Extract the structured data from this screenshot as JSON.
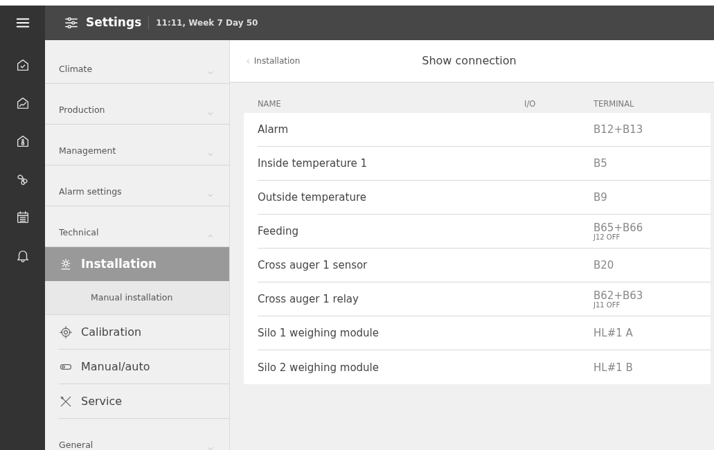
{
  "header": {
    "title": "Settings",
    "clock": "11:11, Week 7 Day 50"
  },
  "sidebar": {
    "groups": [
      {
        "label": "Climate",
        "expanded": false
      },
      {
        "label": "Production",
        "expanded": false
      },
      {
        "label": "Management",
        "expanded": false
      },
      {
        "label": "Alarm settings",
        "expanded": false
      },
      {
        "label": "Technical",
        "expanded": true,
        "items": [
          {
            "label": "Installation",
            "selected": true,
            "children": [
              {
                "label": "Manual installation",
                "selected": false
              }
            ]
          },
          {
            "label": "Calibration",
            "selected": false
          },
          {
            "label": "Manual/auto",
            "selected": false
          },
          {
            "label": "Service",
            "selected": false
          }
        ]
      },
      {
        "label": "General",
        "expanded": false
      }
    ]
  },
  "page": {
    "back": "Installation",
    "title": "Show connection"
  },
  "table": {
    "columns": [
      "NAME",
      "I/O",
      "TERMINAL"
    ],
    "rows": [
      {
        "name": "Alarm",
        "terminal": "B12+B13"
      },
      {
        "name": "Inside temperature 1",
        "terminal": "B5"
      },
      {
        "name": "Outside temperature",
        "terminal": "B9"
      },
      {
        "name": "Feeding",
        "terminal": "B65+B66",
        "note": "J12 OFF"
      },
      {
        "name": "Cross auger 1 sensor",
        "terminal": "B20"
      },
      {
        "name": "Cross auger 1 relay",
        "terminal": "B62+B63",
        "note": "J11 OFF"
      },
      {
        "name": "Silo 1 weighing module",
        "terminal": "HL#1 A"
      },
      {
        "name": "Silo 2 weighing module",
        "terminal": "HL#1 B"
      }
    ]
  }
}
